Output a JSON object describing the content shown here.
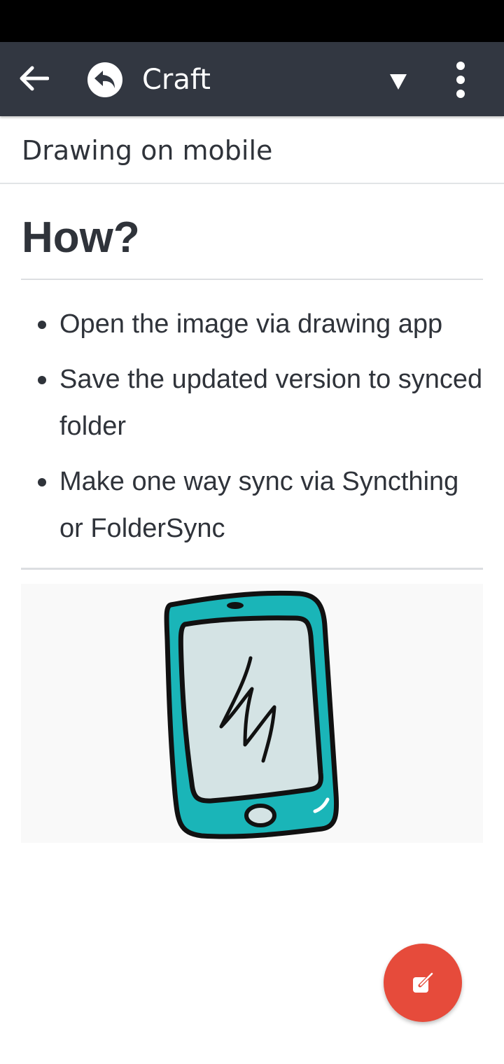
{
  "app_bar": {
    "title": "Craft",
    "icons": {
      "back": "arrow-left-icon",
      "app": "reply-circle-icon",
      "dropdown": "caret-down-icon",
      "more": "more-vertical-icon"
    }
  },
  "breadcrumb": {
    "title": "Drawing on mobile"
  },
  "content": {
    "heading": "How?",
    "bullets": [
      "Open the image via drawing app",
      "Save the updated version to synced folder",
      "Make one way sync via Syncthing or FolderSync"
    ],
    "image_icon": "phone-drawing-icon"
  },
  "fab": {
    "icon": "edit-icon",
    "color": "#e64b3b"
  },
  "colors": {
    "status_bar": "#000000",
    "app_bar": "#323741",
    "text": "#2f333a",
    "phone_teal": "#1ab5b8",
    "phone_screen": "#d4e3e4"
  }
}
